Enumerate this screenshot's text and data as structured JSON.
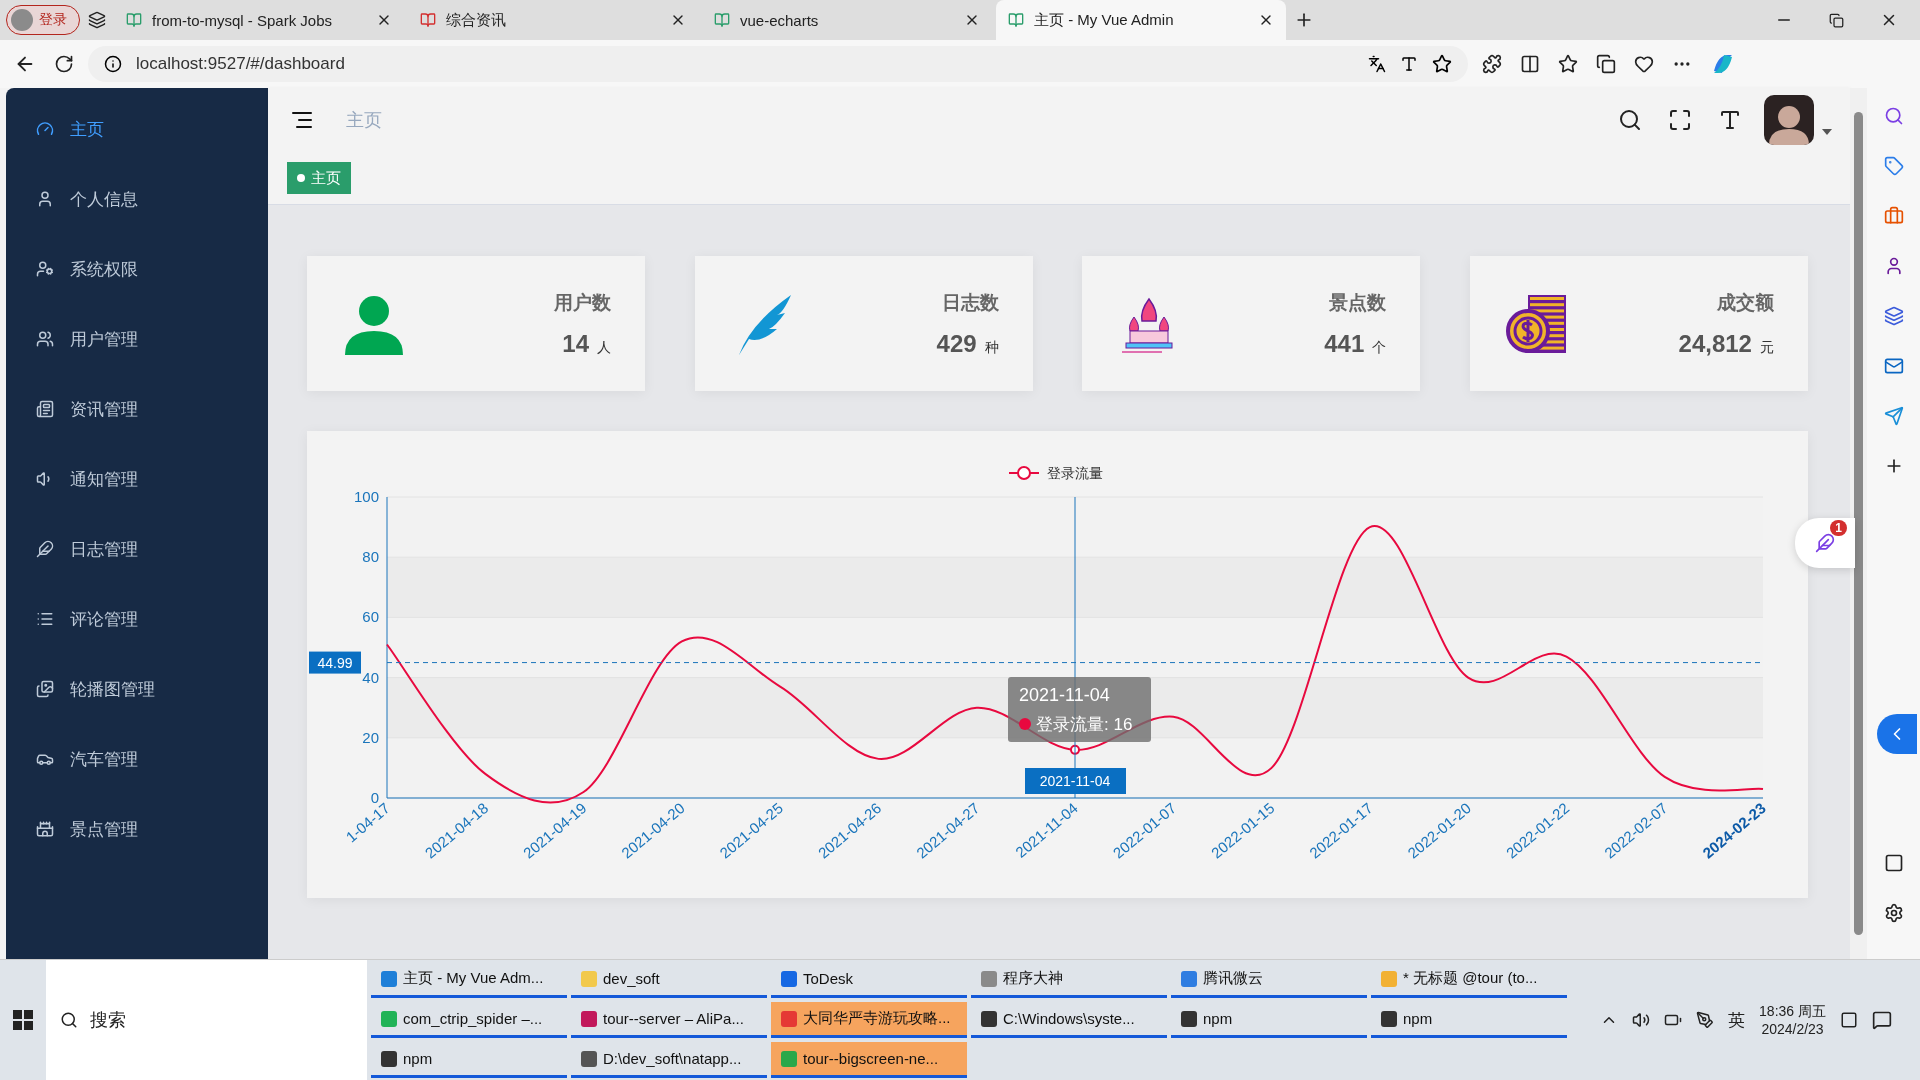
{
  "browser": {
    "profile": "登录",
    "tabs": [
      {
        "title": "from-to-mysql - Spark Jobs",
        "selected": false
      },
      {
        "title": "综合资讯",
        "selected": false
      },
      {
        "title": "vue-echarts",
        "selected": false
      },
      {
        "title": "主页 - My Vue Admin",
        "selected": true
      }
    ],
    "address": "localhost:9527/#/dashboard"
  },
  "sidebar": {
    "items": [
      {
        "label": "主页",
        "selected": true
      },
      {
        "label": "个人信息",
        "selected": false
      },
      {
        "label": "系统权限",
        "selected": false
      },
      {
        "label": "用户管理",
        "selected": false
      },
      {
        "label": "资讯管理",
        "selected": false
      },
      {
        "label": "通知管理",
        "selected": false
      },
      {
        "label": "日志管理",
        "selected": false
      },
      {
        "label": "评论管理",
        "selected": false
      },
      {
        "label": "轮播图管理",
        "selected": false
      },
      {
        "label": "汽车管理",
        "selected": false
      },
      {
        "label": "景点管理",
        "selected": false
      }
    ]
  },
  "header": {
    "breadcrumb": "主页",
    "tag": "主页"
  },
  "stats": [
    {
      "title": "用户数",
      "value": "14",
      "unit": "人"
    },
    {
      "title": "日志数",
      "value": "429",
      "unit": "种"
    },
    {
      "title": "景点数",
      "value": "441",
      "unit": "个"
    },
    {
      "title": "成交额",
      "value": "24,812",
      "unit": "元"
    }
  ],
  "chart": {
    "chart_data": {
      "type": "line",
      "categories": [
        "1-04-17",
        "2021-04-18",
        "2021-04-19",
        "2021-04-20",
        "2021-04-25",
        "2021-04-26",
        "2021-04-27",
        "2021-11-04",
        "2022-01-07",
        "2022-01-15",
        "2022-01-17",
        "2022-01-20",
        "2022-01-22",
        "2022-02-07",
        "2024-02-23"
      ],
      "series": [
        {
          "name": "登录流量",
          "color": "#e8093f",
          "values": [
            51,
            8,
            2,
            52,
            37,
            13,
            30,
            16,
            27,
            10,
            90,
            40,
            47,
            7,
            3
          ]
        }
      ],
      "ylim": [
        0,
        100
      ],
      "yticks": [
        0,
        20,
        40,
        60,
        80,
        100
      ],
      "grid": true,
      "ref_lines": [
        {
          "axis": "y",
          "value": 44.99,
          "label": "44.99"
        },
        {
          "axis": "x",
          "value": "2021-11-04"
        }
      ]
    },
    "pointer_label": "2021-11-04",
    "tooltip": {
      "title": "2021-11-04",
      "text": "登录流量: 16"
    }
  },
  "notification": {
    "badge": "1"
  },
  "taskbar": {
    "search": "搜索",
    "tasks": [
      {
        "title": "主页 - My Vue Adm...",
        "flashing": false,
        "color": "#1e7fd8"
      },
      {
        "title": "dev_soft",
        "flashing": false,
        "color": "#f2c94c"
      },
      {
        "title": "ToDesk",
        "flashing": false,
        "color": "#1668e3"
      },
      {
        "title": "程序大神",
        "flashing": false,
        "color": "#8a8a8a"
      },
      {
        "title": "腾讯微云",
        "flashing": false,
        "color": "#2f7de1"
      },
      {
        "title": "* 无标题 @tour (to...",
        "flashing": false,
        "color": "#f2b134"
      },
      {
        "title": "com_ctrip_spider –...",
        "flashing": false,
        "color": "#21b357"
      },
      {
        "title": "tour--server – AliPa...",
        "flashing": false,
        "color": "#c2185b"
      },
      {
        "title": "大同华严寺游玩攻略...",
        "flashing": true,
        "color": "#e53935"
      },
      {
        "title": "C:\\Windows\\syste...",
        "flashing": false,
        "color": "#333333"
      },
      {
        "title": "npm",
        "flashing": false,
        "color": "#333333"
      },
      {
        "title": "npm",
        "flashing": false,
        "color": "#333333"
      },
      {
        "title": "npm",
        "flashing": false,
        "color": "#333333"
      },
      {
        "title": "D:\\dev_soft\\natapp...",
        "flashing": false,
        "color": "#555555"
      },
      {
        "title": "tour--bigscreen-ne...",
        "flashing": true,
        "color": "#2aa84a"
      }
    ],
    "ime": "英",
    "time": "18:36 周五",
    "date": "2024/2/23"
  }
}
